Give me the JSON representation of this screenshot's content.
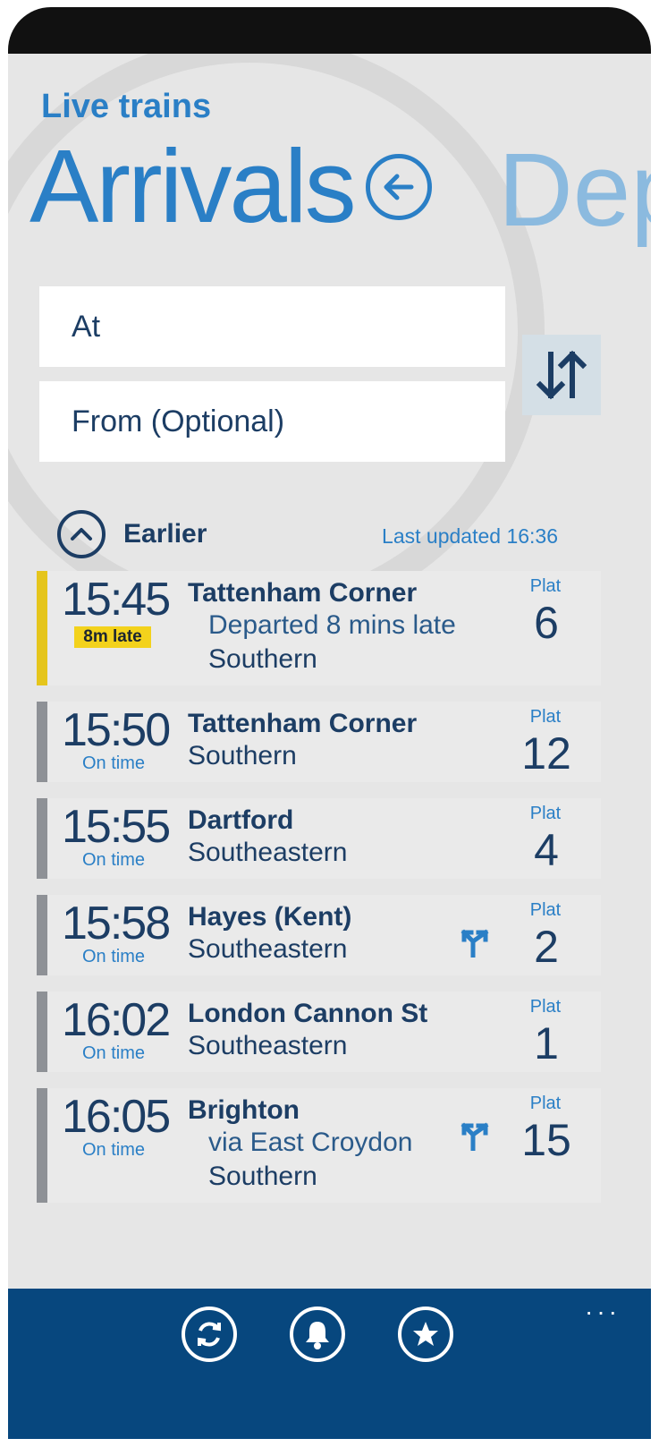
{
  "header": {
    "app_title": "Live trains",
    "pivot_current": "Arrivals",
    "pivot_next": "Dep"
  },
  "search": {
    "at_label": "At",
    "from_label": "From (Optional)"
  },
  "earlier": {
    "label": "Earlier",
    "last_updated": "Last updated 16:36"
  },
  "colors": {
    "accent": "#2a7fc6",
    "dark_text": "#1c3d64",
    "late_bar": "#e5c51c",
    "ontime_bar": "#8e9196",
    "appbar": "#07477e"
  },
  "trains": [
    {
      "time": "15:45",
      "status": "8m late",
      "destination": "Tattenham Corner",
      "sub": "Departed 8 mins late",
      "operator": "Southern",
      "plat_label": "Plat",
      "platform": "6"
    },
    {
      "time": "15:50",
      "status": "On time",
      "destination": "Tattenham Corner",
      "operator": "Southern",
      "plat_label": "Plat",
      "platform": "12"
    },
    {
      "time": "15:55",
      "status": "On time",
      "destination": "Dartford",
      "operator": "Southeastern",
      "plat_label": "Plat",
      "platform": "4"
    },
    {
      "time": "15:58",
      "status": "On time",
      "destination": "Hayes (Kent)",
      "operator": "Southeastern",
      "plat_label": "Plat",
      "platform": "2"
    },
    {
      "time": "16:02",
      "status": "On time",
      "destination": "London Cannon St",
      "operator": "Southeastern",
      "plat_label": "Plat",
      "platform": "1"
    },
    {
      "time": "16:05",
      "status": "On time",
      "destination": "Brighton",
      "sub": "via East Croydon",
      "operator": "Southern",
      "plat_label": "Plat",
      "platform": "15"
    }
  ],
  "appbar": {
    "more": "···",
    "icons": [
      "refresh-icon",
      "bell-icon",
      "star-icon"
    ]
  }
}
